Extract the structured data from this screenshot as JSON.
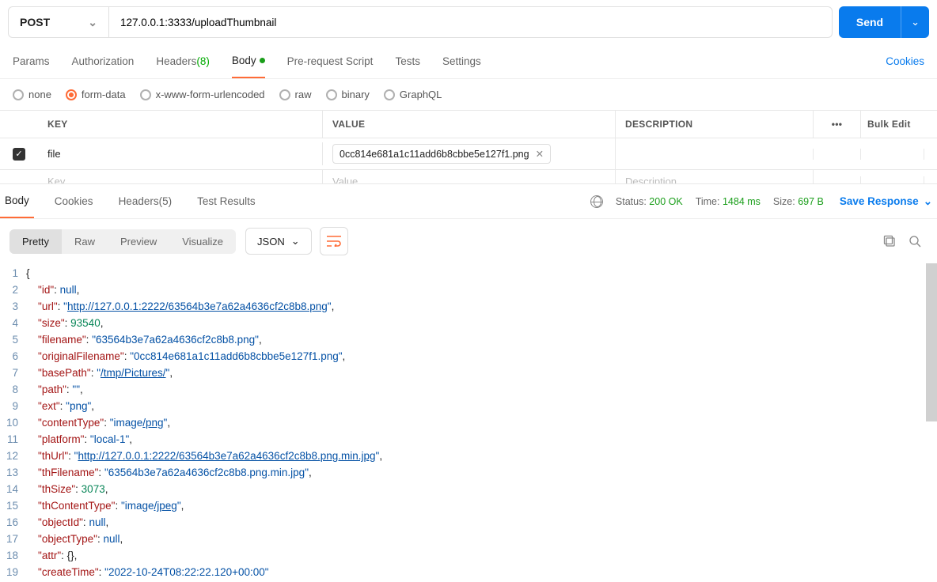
{
  "request": {
    "method": "POST",
    "url": "127.0.0.1:3333/uploadThumbnail",
    "send_label": "Send"
  },
  "req_tabs": {
    "params": "Params",
    "auth": "Authorization",
    "headers": "Headers",
    "headers_count": "(8)",
    "body": "Body",
    "prescript": "Pre-request Script",
    "tests": "Tests",
    "settings": "Settings",
    "cookies": "Cookies"
  },
  "body_types": {
    "none": "none",
    "formdata": "form-data",
    "urlencoded": "x-www-form-urlencoded",
    "raw": "raw",
    "binary": "binary",
    "graphql": "GraphQL"
  },
  "kv": {
    "key_h": "KEY",
    "value_h": "VALUE",
    "desc_h": "DESCRIPTION",
    "bulk": "Bulk Edit",
    "key1": "file",
    "file1": "0cc814e681a1c11add6b8cbbe5e127f1.png",
    "key_ph": "Key",
    "val_ph": "Value",
    "desc_ph": "Description"
  },
  "resp_tabs": {
    "body": "Body",
    "cookies": "Cookies",
    "headers": "Headers",
    "headers_count": "(5)",
    "tests": "Test Results"
  },
  "resp_meta": {
    "status_l": "Status:",
    "status_v": "200 OK",
    "time_l": "Time:",
    "time_v": "1484 ms",
    "size_l": "Size:",
    "size_v": "697 B",
    "save": "Save Response"
  },
  "viewer": {
    "pretty": "Pretty",
    "raw": "Raw",
    "preview": "Preview",
    "visualize": "Visualize",
    "format": "JSON"
  },
  "json_response": {
    "id": null,
    "url": "http://127.0.0.1:2222/63564b3e7a62a4636cf2c8b8.png",
    "size": 93540,
    "filename": "63564b3e7a62a4636cf2c8b8.png",
    "originalFilename": "0cc814e681a1c11add6b8cbbe5e127f1.png",
    "basePath": "/tmp/Pictures/",
    "path": "",
    "ext": "png",
    "contentType": "image/png",
    "platform": "local-1",
    "thUrl": "http://127.0.0.1:2222/63564b3e7a62a4636cf2c8b8.png.min.jpg",
    "thFilename": "63564b3e7a62a4636cf2c8b8.png.min.jpg",
    "thSize": 3073,
    "thContentType": "image/jpeg",
    "objectId": null,
    "objectType": null,
    "attr": "{}",
    "createTime_partial": "\"2022-10-24T08:22:22.120+00:00\""
  }
}
